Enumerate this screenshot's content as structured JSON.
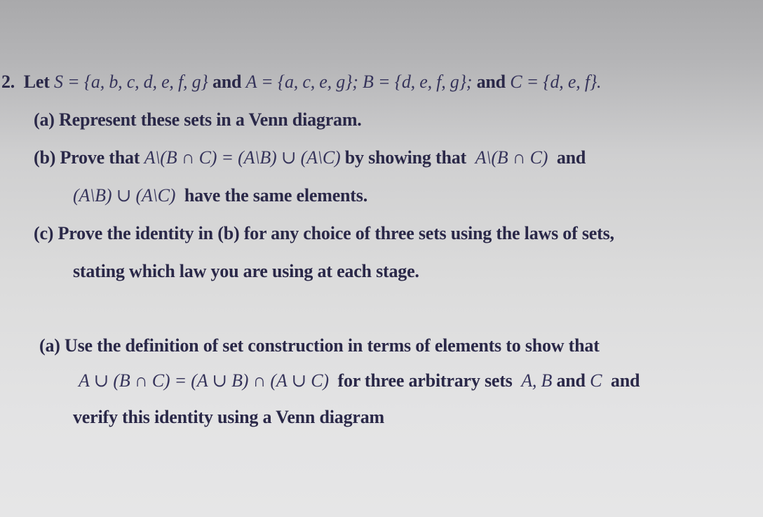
{
  "question": {
    "number": "2.",
    "intro": {
      "lead": "Let",
      "S_def": "S = {a, b, c, d, e, f, g}",
      "and1": "and",
      "A_def": "A = {a, c, e, g};",
      "B_def": "B = {d, e, f, g};",
      "and2": "and",
      "C_def": "C = {d, e, f}."
    },
    "parts": [
      {
        "label": "(a)",
        "text": "Represent these sets in a Venn diagram."
      },
      {
        "label": "(b)",
        "line1": {
          "lead": "Prove that",
          "identity": "A\\(B ∩ C) = (A\\B) ∪ (A\\C)",
          "mid": "by showing that",
          "expr": "A\\(B ∩ C)",
          "tail": "and"
        },
        "line2": {
          "expr": "(A\\B) ∪ (A\\C)",
          "tail": "have the same elements."
        }
      },
      {
        "label": "(c)",
        "line1": "Prove the identity in (b) for any choice of three sets using the laws of sets,",
        "line2": "stating which law you are using at each stage."
      }
    ]
  },
  "question2": {
    "label": "(a)",
    "line1": "Use the definition of set construction in terms of elements to show that",
    "line2": {
      "identity": "A ∪ (B ∩ C) = (A ∪ B) ∩ (A ∪ C)",
      "text": "for three arbitrary sets",
      "sets": "A, B",
      "and1": "and",
      "setC": "C",
      "and2": "and"
    },
    "line3": "verify this identity using a Venn diagram"
  }
}
